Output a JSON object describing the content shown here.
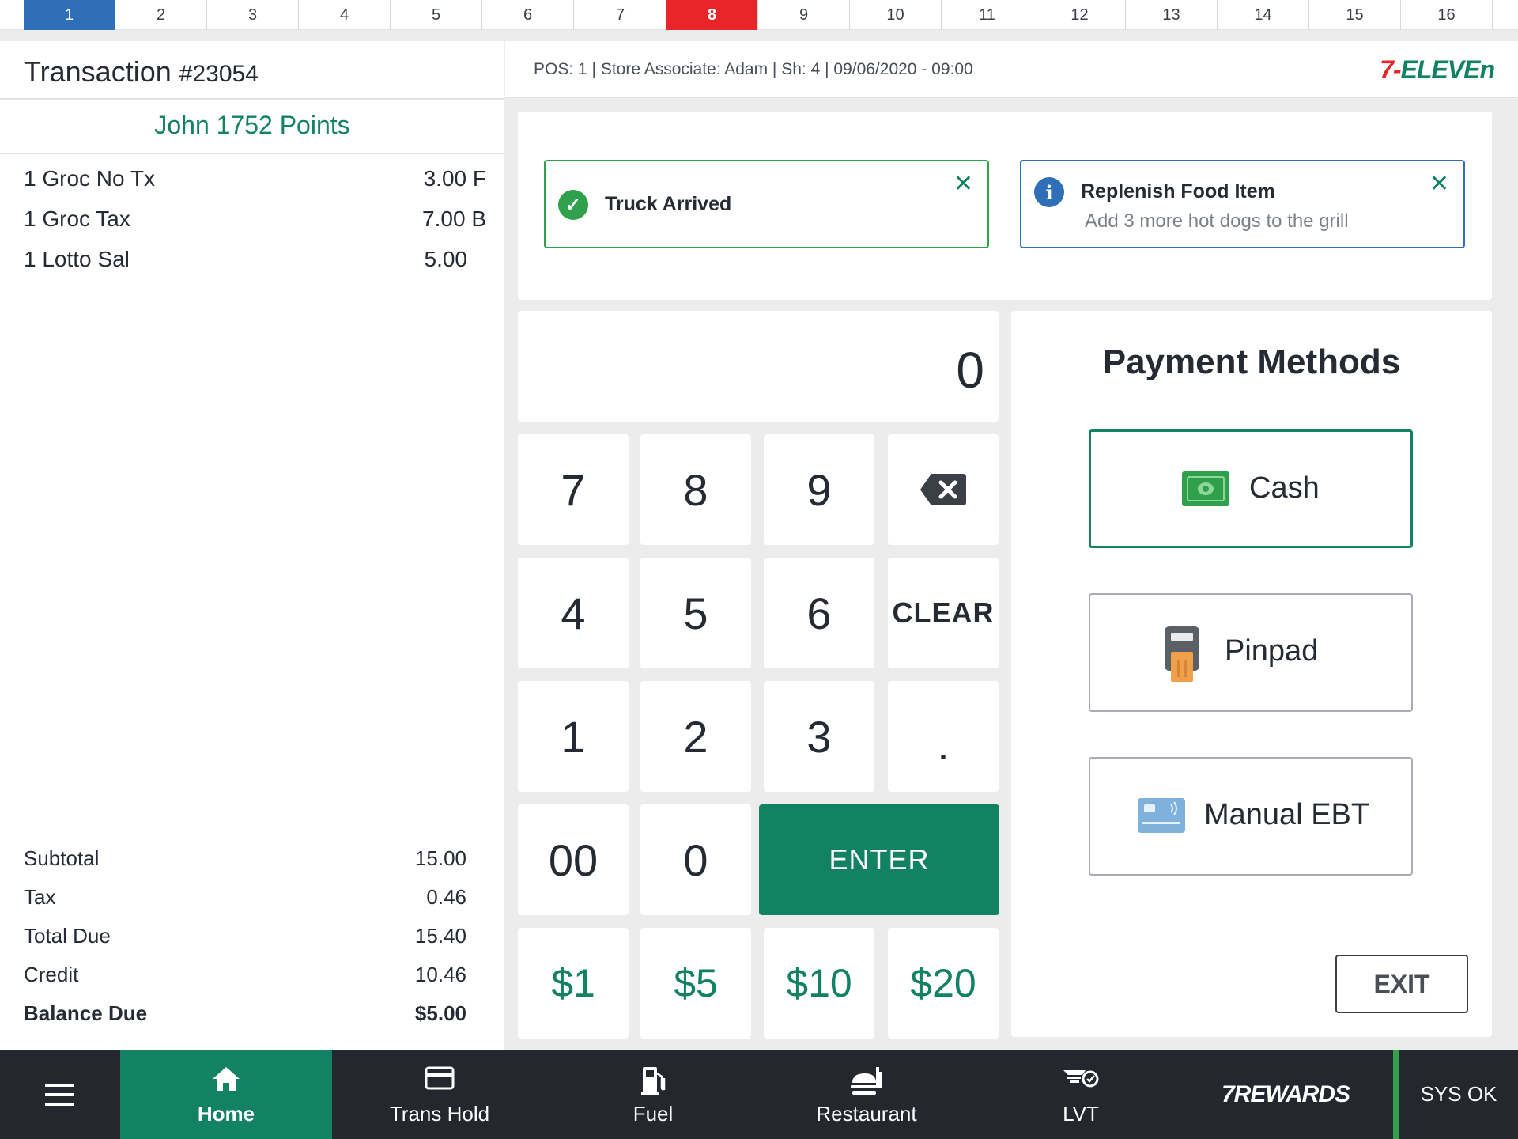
{
  "pos_tabs": {
    "items": [
      "1",
      "2",
      "3",
      "4",
      "5",
      "6",
      "7",
      "8",
      "9",
      "10",
      "11",
      "12",
      "13",
      "14",
      "15",
      "16"
    ],
    "selected": "1",
    "alert": "8",
    "colors": {
      "selected": "#2f6fb7",
      "alert": "#e8262a"
    }
  },
  "transaction": {
    "title": "Transaction",
    "number": "#23054",
    "customer_name": "John",
    "points": "1752 Points",
    "items": [
      {
        "name": "1 Groc No Tx",
        "price": "3.00 F"
      },
      {
        "name": "1 Groc Tax",
        "price": "7.00 B"
      },
      {
        "name": "1 Lotto  Sal",
        "price": "5.00"
      }
    ],
    "summary": [
      {
        "label": "Subtotal",
        "value": "15.00"
      },
      {
        "label": "Tax",
        "value": "0.46"
      },
      {
        "label": "Total Due",
        "value": "15.40"
      },
      {
        "label": "Credit",
        "value": "10.46"
      },
      {
        "label": "Balance Due",
        "value": "$5.00"
      }
    ]
  },
  "header": {
    "pos_info": "POS: 1 | Store Associate: Adam | Sh: 4 | 09/06/2020 - 09:00",
    "logo_prefix": "7-",
    "logo_text": "ELEVEn"
  },
  "notifications": [
    {
      "type": "success",
      "icon": "check-circle-icon",
      "title": "Truck Arrived",
      "close": "✕"
    },
    {
      "type": "info",
      "icon": "info-circle-icon",
      "title": "Replenish Food Item",
      "subtitle": "Add 3 more hot dogs to the grill",
      "close": "✕"
    }
  ],
  "keypad": {
    "display_value": "0",
    "keys": {
      "k7": "7",
      "k8": "8",
      "k9": "9",
      "k4": "4",
      "k5": "5",
      "k6": "6",
      "clear": "CLEAR",
      "k1": "1",
      "k2": "2",
      "k3": "3",
      "dot": ".",
      "k00": "00",
      "k0": "0",
      "enter": "ENTER",
      "m1": "$1",
      "m5": "$5",
      "m10": "$10",
      "m20": "$20"
    }
  },
  "payment": {
    "title": "Payment Methods",
    "methods": [
      {
        "label": "Cash",
        "icon": "cash-icon"
      },
      {
        "label": "Pinpad",
        "icon": "pinpad-icon"
      },
      {
        "label": "Manual EBT",
        "icon": "ebt-card-icon"
      }
    ],
    "exit_label": "EXIT"
  },
  "bottom_nav": {
    "menu_icon": "hamburger-menu-icon",
    "items": [
      {
        "label": "Home",
        "icon": "home-icon",
        "active": true
      },
      {
        "label": "Trans Hold",
        "icon": "card-icon"
      },
      {
        "label": "Fuel",
        "icon": "fuel-pump-icon"
      },
      {
        "label": "Restaurant",
        "icon": "food-icon"
      },
      {
        "label": "LVT",
        "icon": "lvt-icon"
      }
    ],
    "rewards_label": "7REWARDS",
    "status": "SYS OK"
  },
  "colors": {
    "brand_green": "#128262",
    "success": "#2fa04b",
    "info": "#2f6fb7",
    "alert_red": "#e8262a",
    "nav_dark": "#24272d"
  }
}
